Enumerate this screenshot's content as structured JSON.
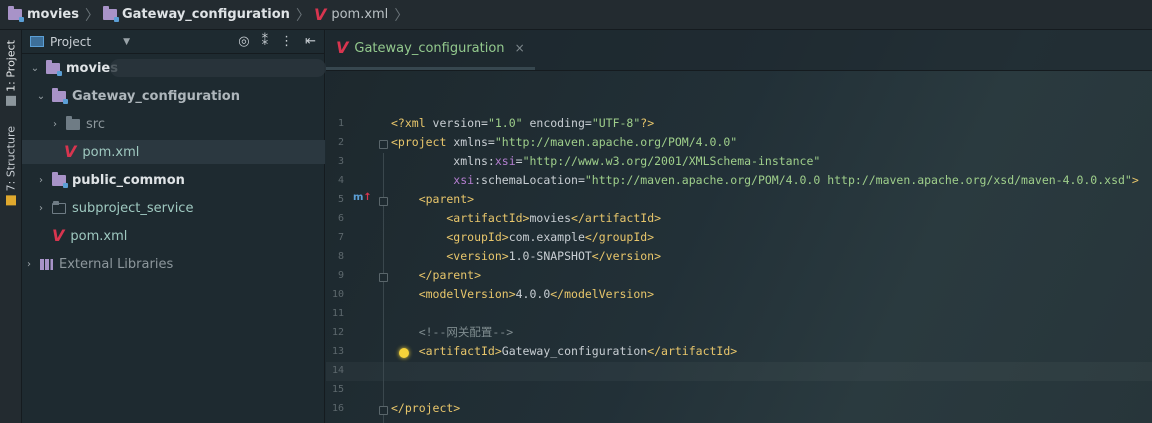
{
  "breadcrumb": [
    {
      "label": "movies",
      "icon": "module-folder-icon"
    },
    {
      "label": "Gateway_configuration",
      "icon": "module-folder-icon"
    },
    {
      "label": "pom.xml",
      "icon": "maven-icon"
    }
  ],
  "stripe": {
    "project_tab": "1: Project",
    "structure_tab": "7: Structure"
  },
  "project_panel": {
    "view_selector": "Project",
    "tree": [
      {
        "label": "movies",
        "depth": 0,
        "expanded": true,
        "style": "bold",
        "icon": "module-folder-icon"
      },
      {
        "label": "Gateway_configuration",
        "depth": 1,
        "expanded": true,
        "style": "bold-dim",
        "icon": "module-folder-icon"
      },
      {
        "label": "src",
        "depth": 2,
        "expanded": false,
        "style": "dim",
        "icon": "folder-icon"
      },
      {
        "label": "pom.xml",
        "depth": 2,
        "expanded": null,
        "style": "teal",
        "icon": "maven-icon",
        "selected": true
      },
      {
        "label": "public_common",
        "depth": 1,
        "expanded": false,
        "style": "bold",
        "icon": "module-folder-icon"
      },
      {
        "label": "subproject_service",
        "depth": 1,
        "expanded": false,
        "style": "teal",
        "icon": "folder-icon"
      },
      {
        "label": "pom.xml",
        "depth": 1,
        "expanded": null,
        "style": "teal",
        "icon": "maven-icon"
      },
      {
        "label": "External Libraries",
        "depth": 0,
        "expanded": false,
        "style": "dim",
        "icon": "libraries-icon"
      }
    ]
  },
  "editor": {
    "tab_label": "Gateway_configuration",
    "tab_close": "×",
    "line_numbers": [
      "1",
      "2",
      "3",
      "4",
      "5",
      "6",
      "7",
      "8",
      "9",
      "10",
      "11",
      "12",
      "13",
      "14",
      "15",
      "16"
    ],
    "lines": [
      "<?xml version=\"1.0\" encoding=\"UTF-8\"?>",
      "<project xmlns=\"http://maven.apache.org/POM/4.0.0\"",
      "         xmlns:xsi=\"http://www.w3.org/2001/XMLSchema-instance\"",
      "         xsi:schemaLocation=\"http://maven.apache.org/POM/4.0.0 http://maven.apache.org/xsd/maven-4.0.0.xsd\">",
      "    <parent>",
      "        <artifactId>movies</artifactId>",
      "        <groupId>com.example</groupId>",
      "        <version>1.0-SNAPSHOT</version>",
      "    </parent>",
      "    <modelVersion>4.0.0</modelVersion>",
      "",
      "    <!--网关配置-->",
      "    <artifactId>Gateway_configuration</artifactId>",
      "",
      "",
      "</project>"
    ]
  },
  "colors": {
    "tag": "#e8c66b",
    "attr_value": "#9fcf8b",
    "namespace": "#b57fd1",
    "maven_red": "#d8354f",
    "accent_blue": "#5b9fd6"
  }
}
